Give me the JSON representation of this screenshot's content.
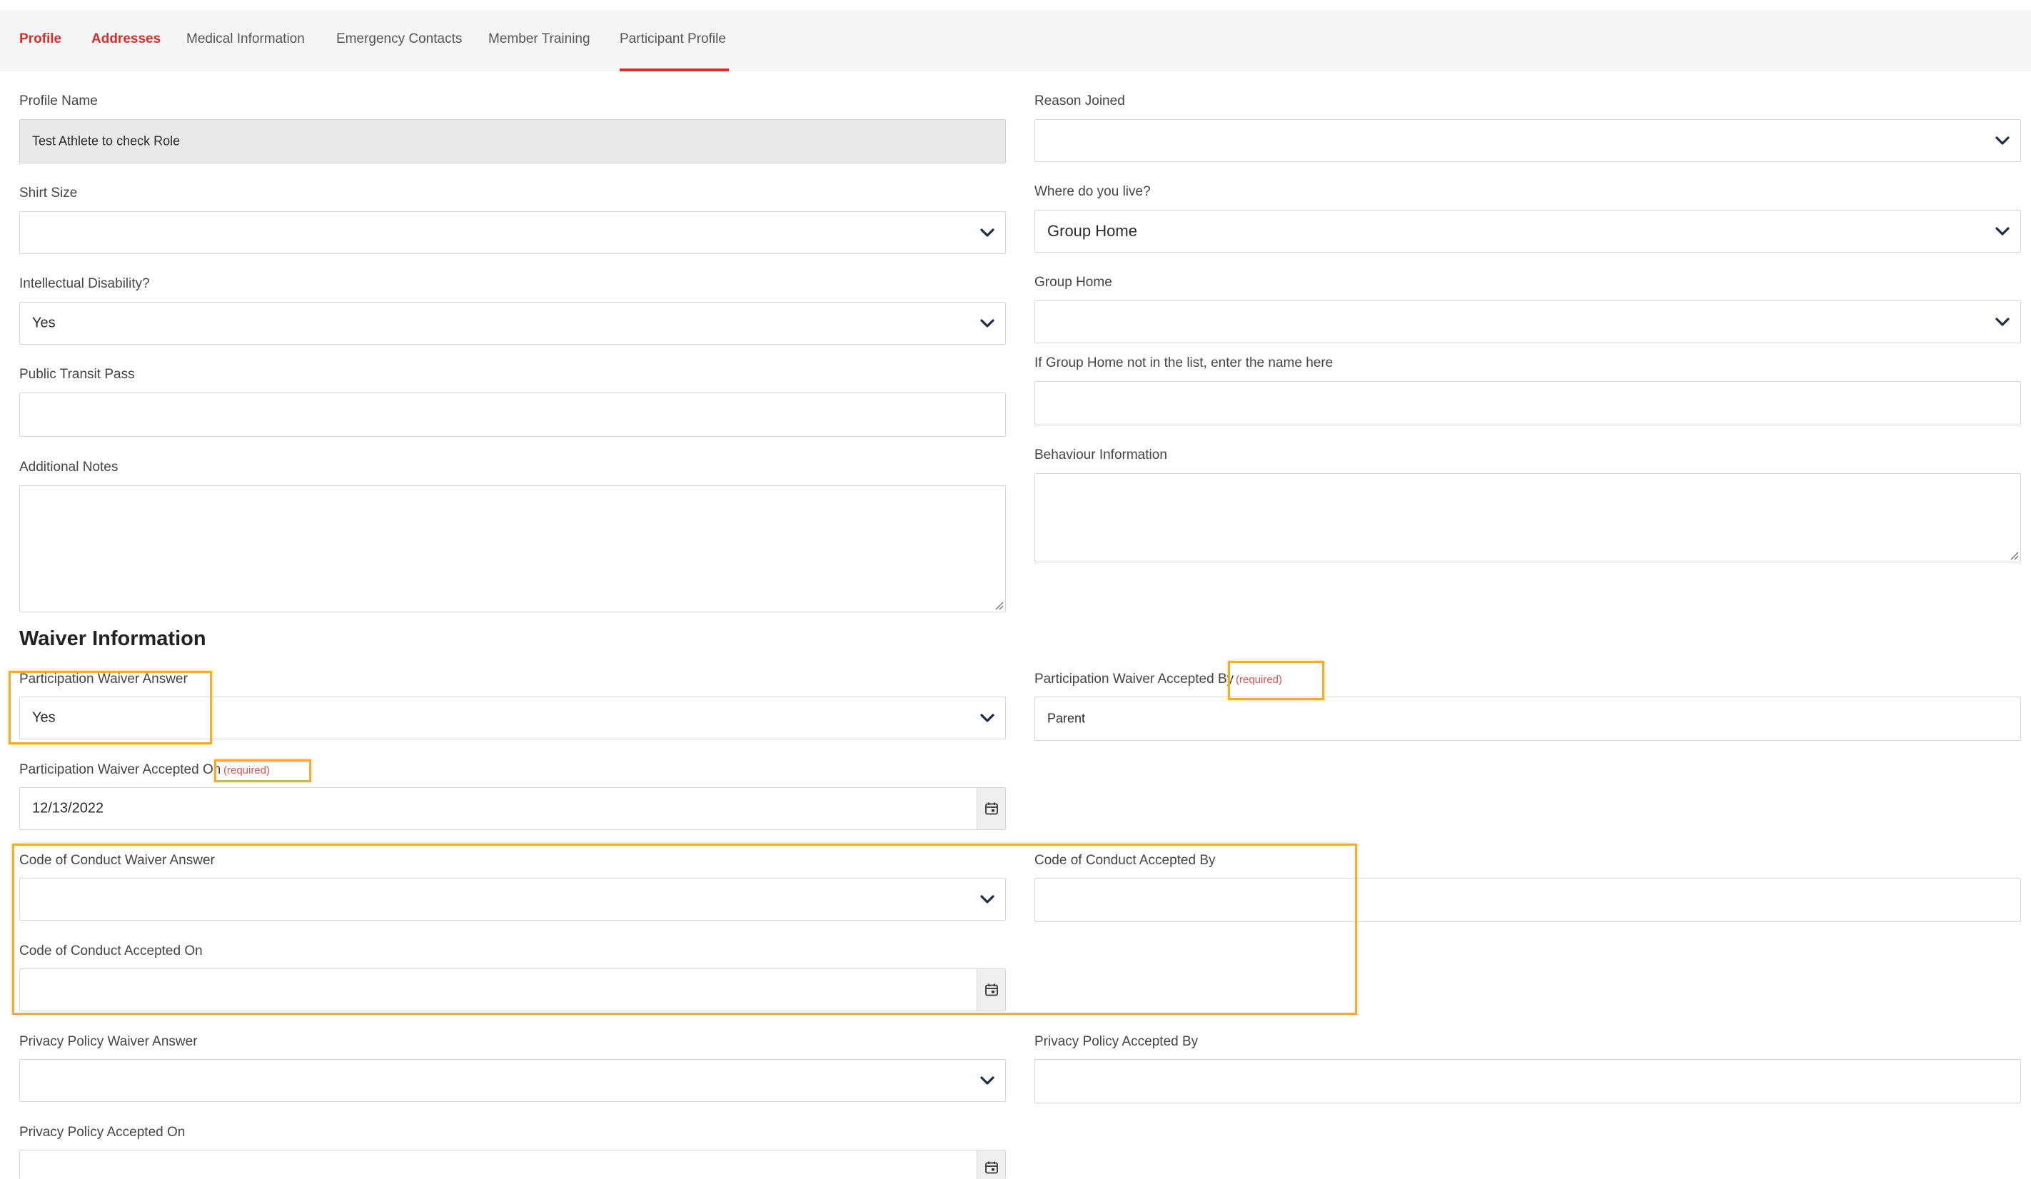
{
  "tabs": [
    {
      "label": "Profile"
    },
    {
      "label": "Addresses"
    },
    {
      "label": "Medical Information"
    },
    {
      "label": "Emergency Contacts"
    },
    {
      "label": "Member Training"
    },
    {
      "label": "Participant Profile"
    }
  ],
  "active_tab": "Participant Profile",
  "form": {
    "profile_name": {
      "label": "Profile Name",
      "value": "Test Athlete to check Role"
    },
    "reason_joined": {
      "label": "Reason Joined",
      "value": ""
    },
    "shirt_size": {
      "label": "Shirt Size",
      "value": ""
    },
    "where_live": {
      "label": "Where do you live?",
      "value": "Group Home"
    },
    "intellectual_disability": {
      "label": "Intellectual Disability?",
      "value": "Yes"
    },
    "group_home": {
      "label": "Group Home",
      "value": ""
    },
    "group_home_other": {
      "label": "If Group Home not in the list, enter the name here",
      "value": ""
    },
    "public_transit_pass": {
      "label": "Public Transit Pass",
      "value": ""
    },
    "additional_notes": {
      "label": "Additional Notes",
      "value": ""
    },
    "behaviour_information": {
      "label": "Behaviour Information",
      "value": ""
    }
  },
  "waiver": {
    "section_title": "Waiver Information",
    "required_text": "(required)",
    "participation_answer": {
      "label": "Participation Waiver Answer",
      "value": "Yes"
    },
    "participation_accepted_by": {
      "label": "Participation Waiver Accepted By",
      "value": "Parent"
    },
    "participation_accepted_on": {
      "label": "Participation Waiver Accepted On",
      "value": "12/13/2022"
    },
    "conduct_answer": {
      "label": "Code of Conduct Waiver Answer",
      "value": ""
    },
    "conduct_accepted_by": {
      "label": "Code of Conduct Accepted By",
      "value": ""
    },
    "conduct_accepted_on": {
      "label": "Code of Conduct Accepted On",
      "value": ""
    },
    "privacy_answer": {
      "label": "Privacy Policy Waiver Answer",
      "value": ""
    },
    "privacy_accepted_by": {
      "label": "Privacy Policy Accepted By",
      "value": ""
    },
    "privacy_accepted_on": {
      "label": "Privacy Policy Accepted On",
      "value": ""
    }
  },
  "colors": {
    "accent": "#d62d2d",
    "highlight": "#f0ad35",
    "required": "#d9534f",
    "readonly_bg": "#e9e9e9"
  },
  "icons": [
    "chevron-down-icon",
    "calendar-icon",
    "resize-grip-icon"
  ]
}
